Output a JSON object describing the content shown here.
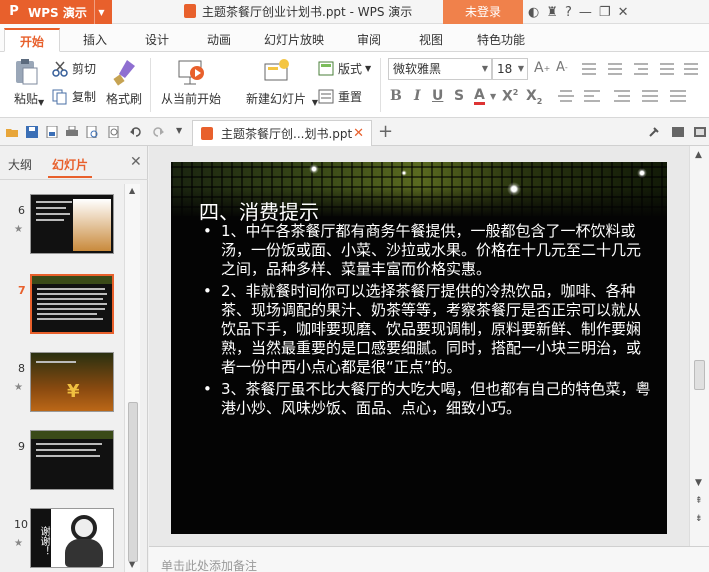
{
  "titlebar": {
    "app_name": "WPS 演示",
    "document_title": "主题茶餐厅创业计划书.ppt - WPS 演示",
    "login_label": "未登录"
  },
  "menu": {
    "tabs": [
      "开始",
      "插入",
      "设计",
      "动画",
      "幻灯片放映",
      "审阅",
      "视图",
      "特色功能"
    ],
    "active": "开始"
  },
  "ribbon": {
    "paste": "粘贴",
    "cut": "剪切",
    "copy": "复制",
    "format_painter": "格式刷",
    "from_current": "从当前开始",
    "new_slide": "新建幻灯片",
    "layout": "版式",
    "reset": "重置",
    "font_name": "微软雅黑",
    "font_size": "18"
  },
  "doc_tab": {
    "label": "主题茶餐厅创...划书.ppt"
  },
  "left_panel": {
    "tabs": [
      "大纲",
      "幻灯片"
    ],
    "active_tab": "幻灯片",
    "slides": [
      {
        "num": "6"
      },
      {
        "num": "7"
      },
      {
        "num": "8"
      },
      {
        "num": "9"
      },
      {
        "num": "10",
        "text": "谢谢！"
      }
    ],
    "active_slide": "7"
  },
  "slide": {
    "title": "四、消费提示",
    "bullets": [
      "1、中午各茶餐厅都有商务午餐提供，一般都包含了一杯饮料或汤，一份饭或面、小菜、沙拉或水果。价格在十几元至二十几元之间，品种多样、菜量丰富而价格实惠。",
      "2、非就餐时间你可以选择茶餐厅提供的冷热饮品，咖啡、各种茶、现场调配的果汁、奶茶等等，考察茶餐厅是否正宗可以就从饮品下手，咖啡要现磨、饮品要现调制，原料要新鲜、制作要娴熟，当然最重要的是口感要细腻。同时，搭配一小块三明治，或者一份中西小点心都是很“正点”的。",
      "3、茶餐厅虽不比大餐厅的大吃大喝，但也都有自己的特色菜，粤港小炒、风味炒饭、面品、点心，细致小巧。"
    ]
  },
  "notes": {
    "placeholder": "单击此处添加备注"
  },
  "colors": {
    "accent": "#e8602c",
    "slide_background": "#040404"
  }
}
